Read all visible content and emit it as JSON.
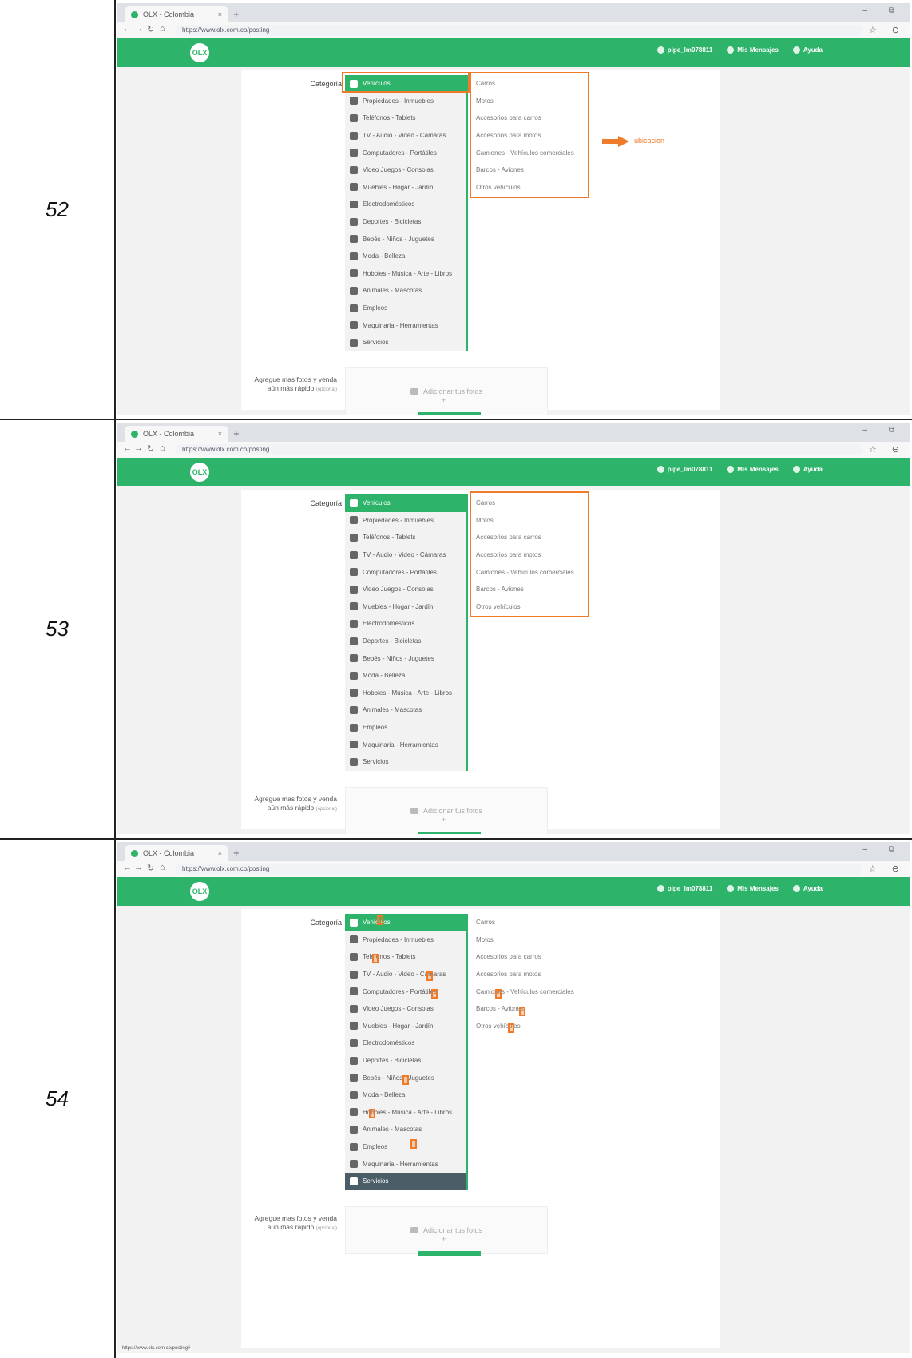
{
  "rows": [
    {
      "number": "52",
      "hover_index": -1,
      "mode": "box-arrow"
    },
    {
      "number": "53",
      "hover_index": -1,
      "mode": "box"
    },
    {
      "number": "54",
      "hover_index": 15,
      "mode": "marks"
    }
  ],
  "browser": {
    "tab_title": "OLX - Colombia",
    "tab_close": "×",
    "new_tab": "+",
    "window_controls": "– ⧉",
    "url": "https://www.olx.com.co/posting",
    "toolbar_icons": "☆ ⊖"
  },
  "site": {
    "logo": "OLX",
    "user": "pipe_lm078811",
    "messages": "Mis Mensajes",
    "help": "Ayuda"
  },
  "form": {
    "category_label": "Categoría",
    "categories": [
      "Vehículos",
      "Propiedades - Inmuebles",
      "Teléfonos - Tablets",
      "TV - Audio - Video - Cámaras",
      "Computadores - Portátiles",
      "Video Juegos - Consolas",
      "Muebles - Hogar - Jardín",
      "Electrodomésticos",
      "Deportes - Bicicletas",
      "Bebés - Niños - Juguetes",
      "Moda - Belleza",
      "Hobbies - Música - Arte - Libros",
      "Animales - Mascotas",
      "Empleos",
      "Maquinaria - Herramientas",
      "Servicios"
    ],
    "subcategories": [
      "Carros",
      "Motos",
      "Accesorios para carros",
      "Accesorios para motos",
      "Camiones - Vehículos comerciales",
      "Barcos - Aviones",
      "Otros vehículos"
    ],
    "upload_label_line1": "Agregue mas fotos y venda",
    "upload_label_line2": "aún más rápido",
    "upload_optional": "(opcional)",
    "upload_button": "Adicionar tus fotos",
    "upload_plus": "+"
  },
  "annotation": {
    "arrow_label": "ubicacion",
    "arrow_color": "#ee7a2a"
  },
  "statusbar_url": "https://www.olx.com.co/posting#"
}
